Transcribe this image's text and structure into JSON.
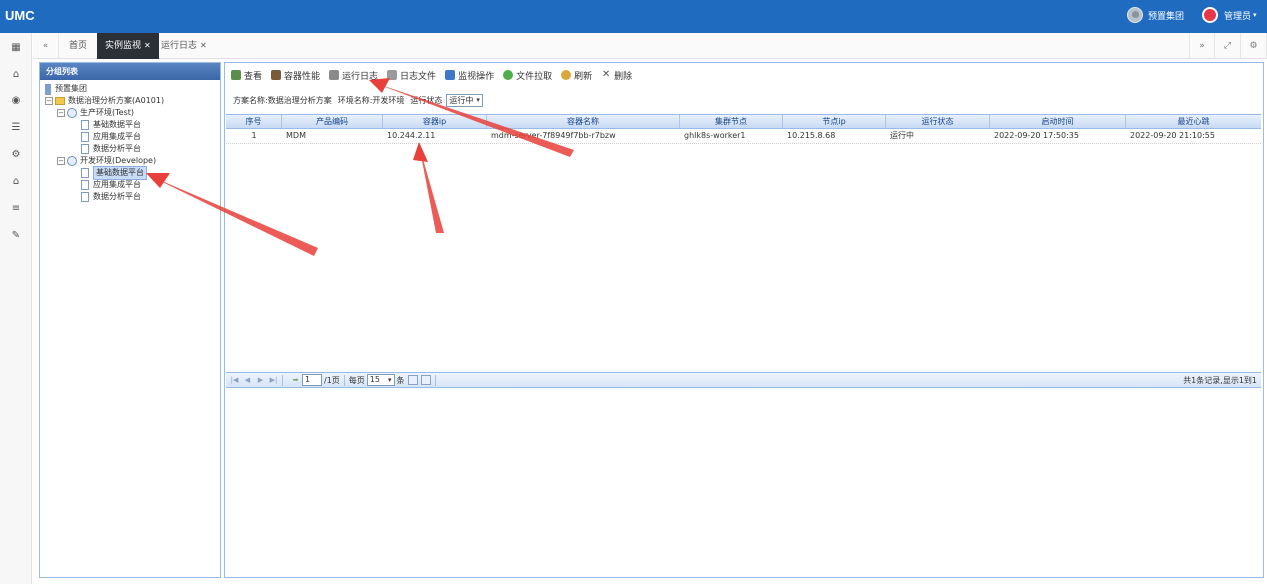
{
  "header": {
    "brand": "UMC",
    "org_name": "预置集团",
    "user_name": "管理员"
  },
  "colors": {
    "header_bg": "#1e6bbf",
    "active_tab": "#2b2f36",
    "grid_header": "#c7daf3",
    "annotation_red": "#e8403a"
  },
  "rail_icons": [
    "dashboard-icon",
    "bank-icon",
    "eye-icon",
    "list-icon",
    "settings-icon",
    "home-icon",
    "menu-icon",
    "wrench-icon"
  ],
  "tabs": [
    {
      "label": "首页"
    },
    {
      "label": "实例监视",
      "active": true
    },
    {
      "label": "运行日志"
    }
  ],
  "tree_panel": {
    "title": "分组列表",
    "nodes": {
      "root": "预置集团",
      "solution": "数据治理分析方案(A0101)",
      "env_test": "生产环境(Test)",
      "test_base": "基础数据平台",
      "test_app": "应用集成平台",
      "test_data": "数据分析平台",
      "env_dev": "开发环境(Develope)",
      "dev_base": "基础数据平台",
      "dev_app": "应用集成平台",
      "dev_data": "数据分析平台"
    }
  },
  "toolbar": {
    "view": "查看",
    "container_perf": "容器性能",
    "run_log": "运行日志",
    "log_file": "日志文件",
    "monitor_ops": "监视操作",
    "file_pull": "文件拉取",
    "refresh": "刷新",
    "delete": "删除"
  },
  "filter": {
    "solution_text": "方案名称:数据治理分析方案",
    "env_text": "环境名称:开发环境",
    "status_label": "运行状态",
    "status_value": "运行中"
  },
  "grid": {
    "columns": [
      "序号",
      "产品编码",
      "容器ip",
      "容器名称",
      "集群节点",
      "节点ip",
      "运行状态",
      "启动时间",
      "最近心跳"
    ],
    "rows": [
      [
        "1",
        "MDM",
        "10.244.2.11",
        "mdm-server-7f8949f7bb-r7bzw",
        "ghlk8s-worker1",
        "10.215.8.68",
        "运行中",
        "2022-09-20 17:50:35",
        "2022-09-20 21:10:55"
      ]
    ]
  },
  "pager": {
    "page": "1",
    "total_pages_text": "/1页",
    "per_page_label": "每页",
    "per_page_value": "15",
    "unit": "条",
    "summary": "共1条记录,显示1到1"
  }
}
